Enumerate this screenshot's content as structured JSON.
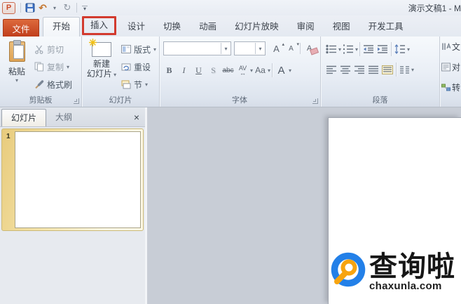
{
  "window": {
    "title": "演示文稿1 - M"
  },
  "qat": {
    "pp_letter": "P",
    "undo_glyph": "↶",
    "redo_glyph": "↻"
  },
  "tabs": {
    "file": "文件",
    "items": [
      "开始",
      "插入",
      "设计",
      "切换",
      "动画",
      "幻灯片放映",
      "审阅",
      "视图",
      "开发工具"
    ]
  },
  "ribbon": {
    "clipboard": {
      "label": "剪贴板",
      "paste": "粘贴",
      "cut": "剪切",
      "copy": "复制",
      "format_painter": "格式刷"
    },
    "slides": {
      "label": "幻灯片",
      "new_slide_l1": "新建",
      "new_slide_l2": "幻灯片",
      "layout": "版式",
      "reset": "重设",
      "section": "节"
    },
    "font": {
      "label": "字体",
      "bold": "B",
      "italic": "I",
      "underline": "U",
      "shadow": "S",
      "strikethrough": "abc",
      "spacing": "AV",
      "spacing_arrow": "↔",
      "case": "Aa",
      "color": "A",
      "grow": "A",
      "shrink": "A",
      "clear": "A"
    },
    "paragraph": {
      "label": "段落"
    },
    "more": {
      "text_direction": "文",
      "align_text": "对",
      "smartart": "转"
    }
  },
  "panel": {
    "tab_slides": "幻灯片",
    "tab_outline": "大纲",
    "close_glyph": "×",
    "slide_number": "1"
  },
  "watermark": {
    "brand": "查询啦",
    "domain": "chaxunla.com"
  },
  "colors": {
    "annotation_red": "#d23a2e",
    "file_tab_orange": "#c94a2d",
    "logo_blue": "#2380e8",
    "logo_orange": "#f7a410",
    "selection_gold": "#e8cb7c"
  }
}
